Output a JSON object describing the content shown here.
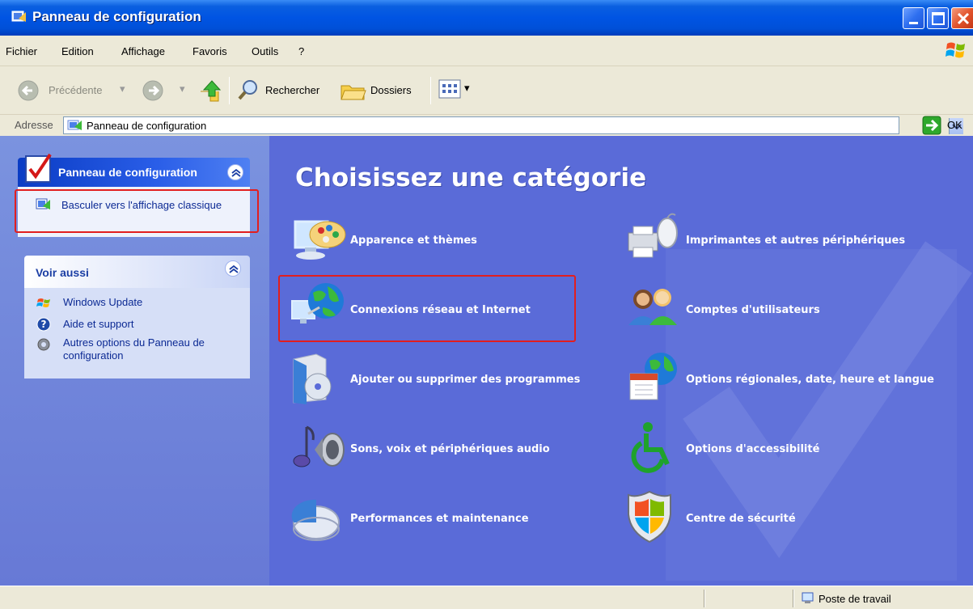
{
  "window": {
    "title": "Panneau de configuration"
  },
  "menu": {
    "items": [
      "Fichier",
      "Edition",
      "Affichage",
      "Favoris",
      "Outils",
      "?"
    ]
  },
  "toolbar": {
    "back_label": "Précédente",
    "search_label": "Rechercher",
    "folders_label": "Dossiers"
  },
  "address": {
    "label": "Adresse",
    "value": "Panneau de configuration",
    "go_label": "OK"
  },
  "left_pane": {
    "task_panel_title": "Panneau de configuration",
    "switch_view_link": "Basculer vers l'affichage classique",
    "see_also_title": "Voir aussi",
    "see_also_links": [
      "Windows Update",
      "Aide et support",
      "Autres options du Panneau de configuration"
    ]
  },
  "main": {
    "heading": "Choisissez une catégorie",
    "categories": [
      "Apparence et thèmes",
      "Imprimantes et autres périphériques",
      "Connexions réseau et Internet",
      "Comptes d'utilisateurs",
      "Ajouter ou supprimer des programmes",
      "Options régionales, date, heure et langue",
      "Sons, voix et périphériques audio",
      "Options d'accessibilité",
      "Performances et maintenance",
      "Centre de sécurité"
    ]
  },
  "statusbar": {
    "location": "Poste de travail"
  },
  "colors": {
    "titlebar": "#0054e3",
    "content_bg": "#5a6bd8",
    "highlight_box": "#e21e1e"
  }
}
